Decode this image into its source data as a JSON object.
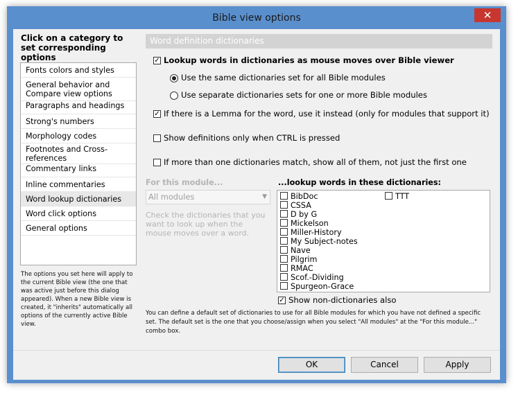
{
  "window": {
    "title": "Bible view options",
    "close_glyph": "✕"
  },
  "categories": {
    "header": "Click on a category to set corresponding options",
    "items": [
      "Fonts colors and styles",
      "General behavior and Compare view options",
      "Paragraphs and headings",
      "Strong's numbers",
      "Morphology codes",
      "Footnotes and Cross-references",
      "Commentary links",
      "Inline commentaries",
      "Word lookup dictionaries",
      "Word click options",
      "General options"
    ],
    "selected": "Word lookup dictionaries",
    "note": "The options you set here will apply to the current Bible view (the one that was active just before this dialog appeared). When a new Bible view is created, it \"inherits\" automatically all options of the currently active Bible view."
  },
  "section": {
    "title": "Word definition dictionaries",
    "lookup_mouse": {
      "label": "Lookup words in dictionaries as mouse moves over Bible viewer",
      "checked": true
    },
    "radio_same": {
      "label": "Use the same dictionaries set for all Bible modules",
      "selected": true
    },
    "radio_separate": {
      "label": "Use separate dictionaries sets for one or more Bible modules",
      "selected": false
    },
    "lemma": {
      "label": "If there is a Lemma for the word, use it instead (only for modules that support it)",
      "checked": true
    },
    "ctrl_only": {
      "label": "Show definitions only when CTRL is pressed",
      "checked": false
    },
    "show_all": {
      "label": "If more than one dictionaries match, show all of them, not just the first one",
      "checked": false
    }
  },
  "module": {
    "label": "For this module...",
    "selected_value": "All modules",
    "hint": "Check the dictionaries that you want to look up when the mouse moves over a word."
  },
  "dictionaries": {
    "label": "...lookup words in these dictionaries:",
    "left_column": [
      "BibDoc",
      "CSSA",
      "D by G",
      "Mickelson",
      "Miller-History",
      "My Subject-notes",
      "Nave",
      "Pilgrim",
      "RMAC",
      "Scof.-Dividing",
      "Spurgeon-Grace"
    ],
    "right_column": [
      "TTT"
    ],
    "show_non_dictionaries": {
      "label": "Show non-dictionaries also",
      "checked": true
    }
  },
  "footnote": "You can define a default set of dictionaries to use for all Bible modules for which you have not defined a specific set. The default set is the one that you choose/assign when you select \"All modules\" at the \"For this module...\" combo box.",
  "buttons": {
    "ok": "OK",
    "cancel": "Cancel",
    "apply": "Apply"
  },
  "colors": {
    "frame": "#5a8fce",
    "close": "#c7372f",
    "section_header": "#d3d3d3"
  }
}
